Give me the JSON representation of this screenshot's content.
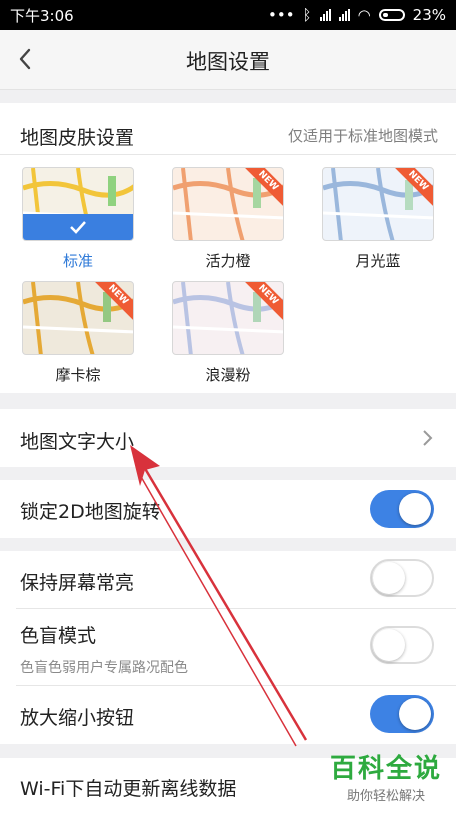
{
  "status_bar": {
    "time": "下午3:06",
    "battery": "23%"
  },
  "header": {
    "title": "地图设置"
  },
  "skin": {
    "label": "地图皮肤设置",
    "note": "仅适用于标准地图模式",
    "items": [
      {
        "label": "标准",
        "selected": true,
        "new": false
      },
      {
        "label": "活力橙",
        "selected": false,
        "new": true
      },
      {
        "label": "月光蓝",
        "selected": false,
        "new": true
      },
      {
        "label": "摩卡棕",
        "selected": false,
        "new": true
      },
      {
        "label": "浪漫粉",
        "selected": false,
        "new": true
      }
    ],
    "new_badge": "NEW"
  },
  "text_size": {
    "label": "地图文字大小"
  },
  "lock_2d": {
    "label": "锁定2D地图旋转",
    "enabled": true
  },
  "keep_screen": {
    "label": "保持屏幕常亮",
    "enabled": false
  },
  "color_blind": {
    "label": "色盲模式",
    "sub": "色盲色弱用户专属路况配色",
    "enabled": false
  },
  "zoom_buttons": {
    "label": "放大缩小按钮",
    "enabled": true
  },
  "wifi_update": {
    "label": "Wi-Fi下自动更新离线数据"
  },
  "watermark": {
    "main": "百科全说",
    "sub": "助你轻松解决"
  },
  "colors": {
    "accent": "#3d82e4",
    "badge": "#ef5b34",
    "arrow": "#d8323c"
  }
}
